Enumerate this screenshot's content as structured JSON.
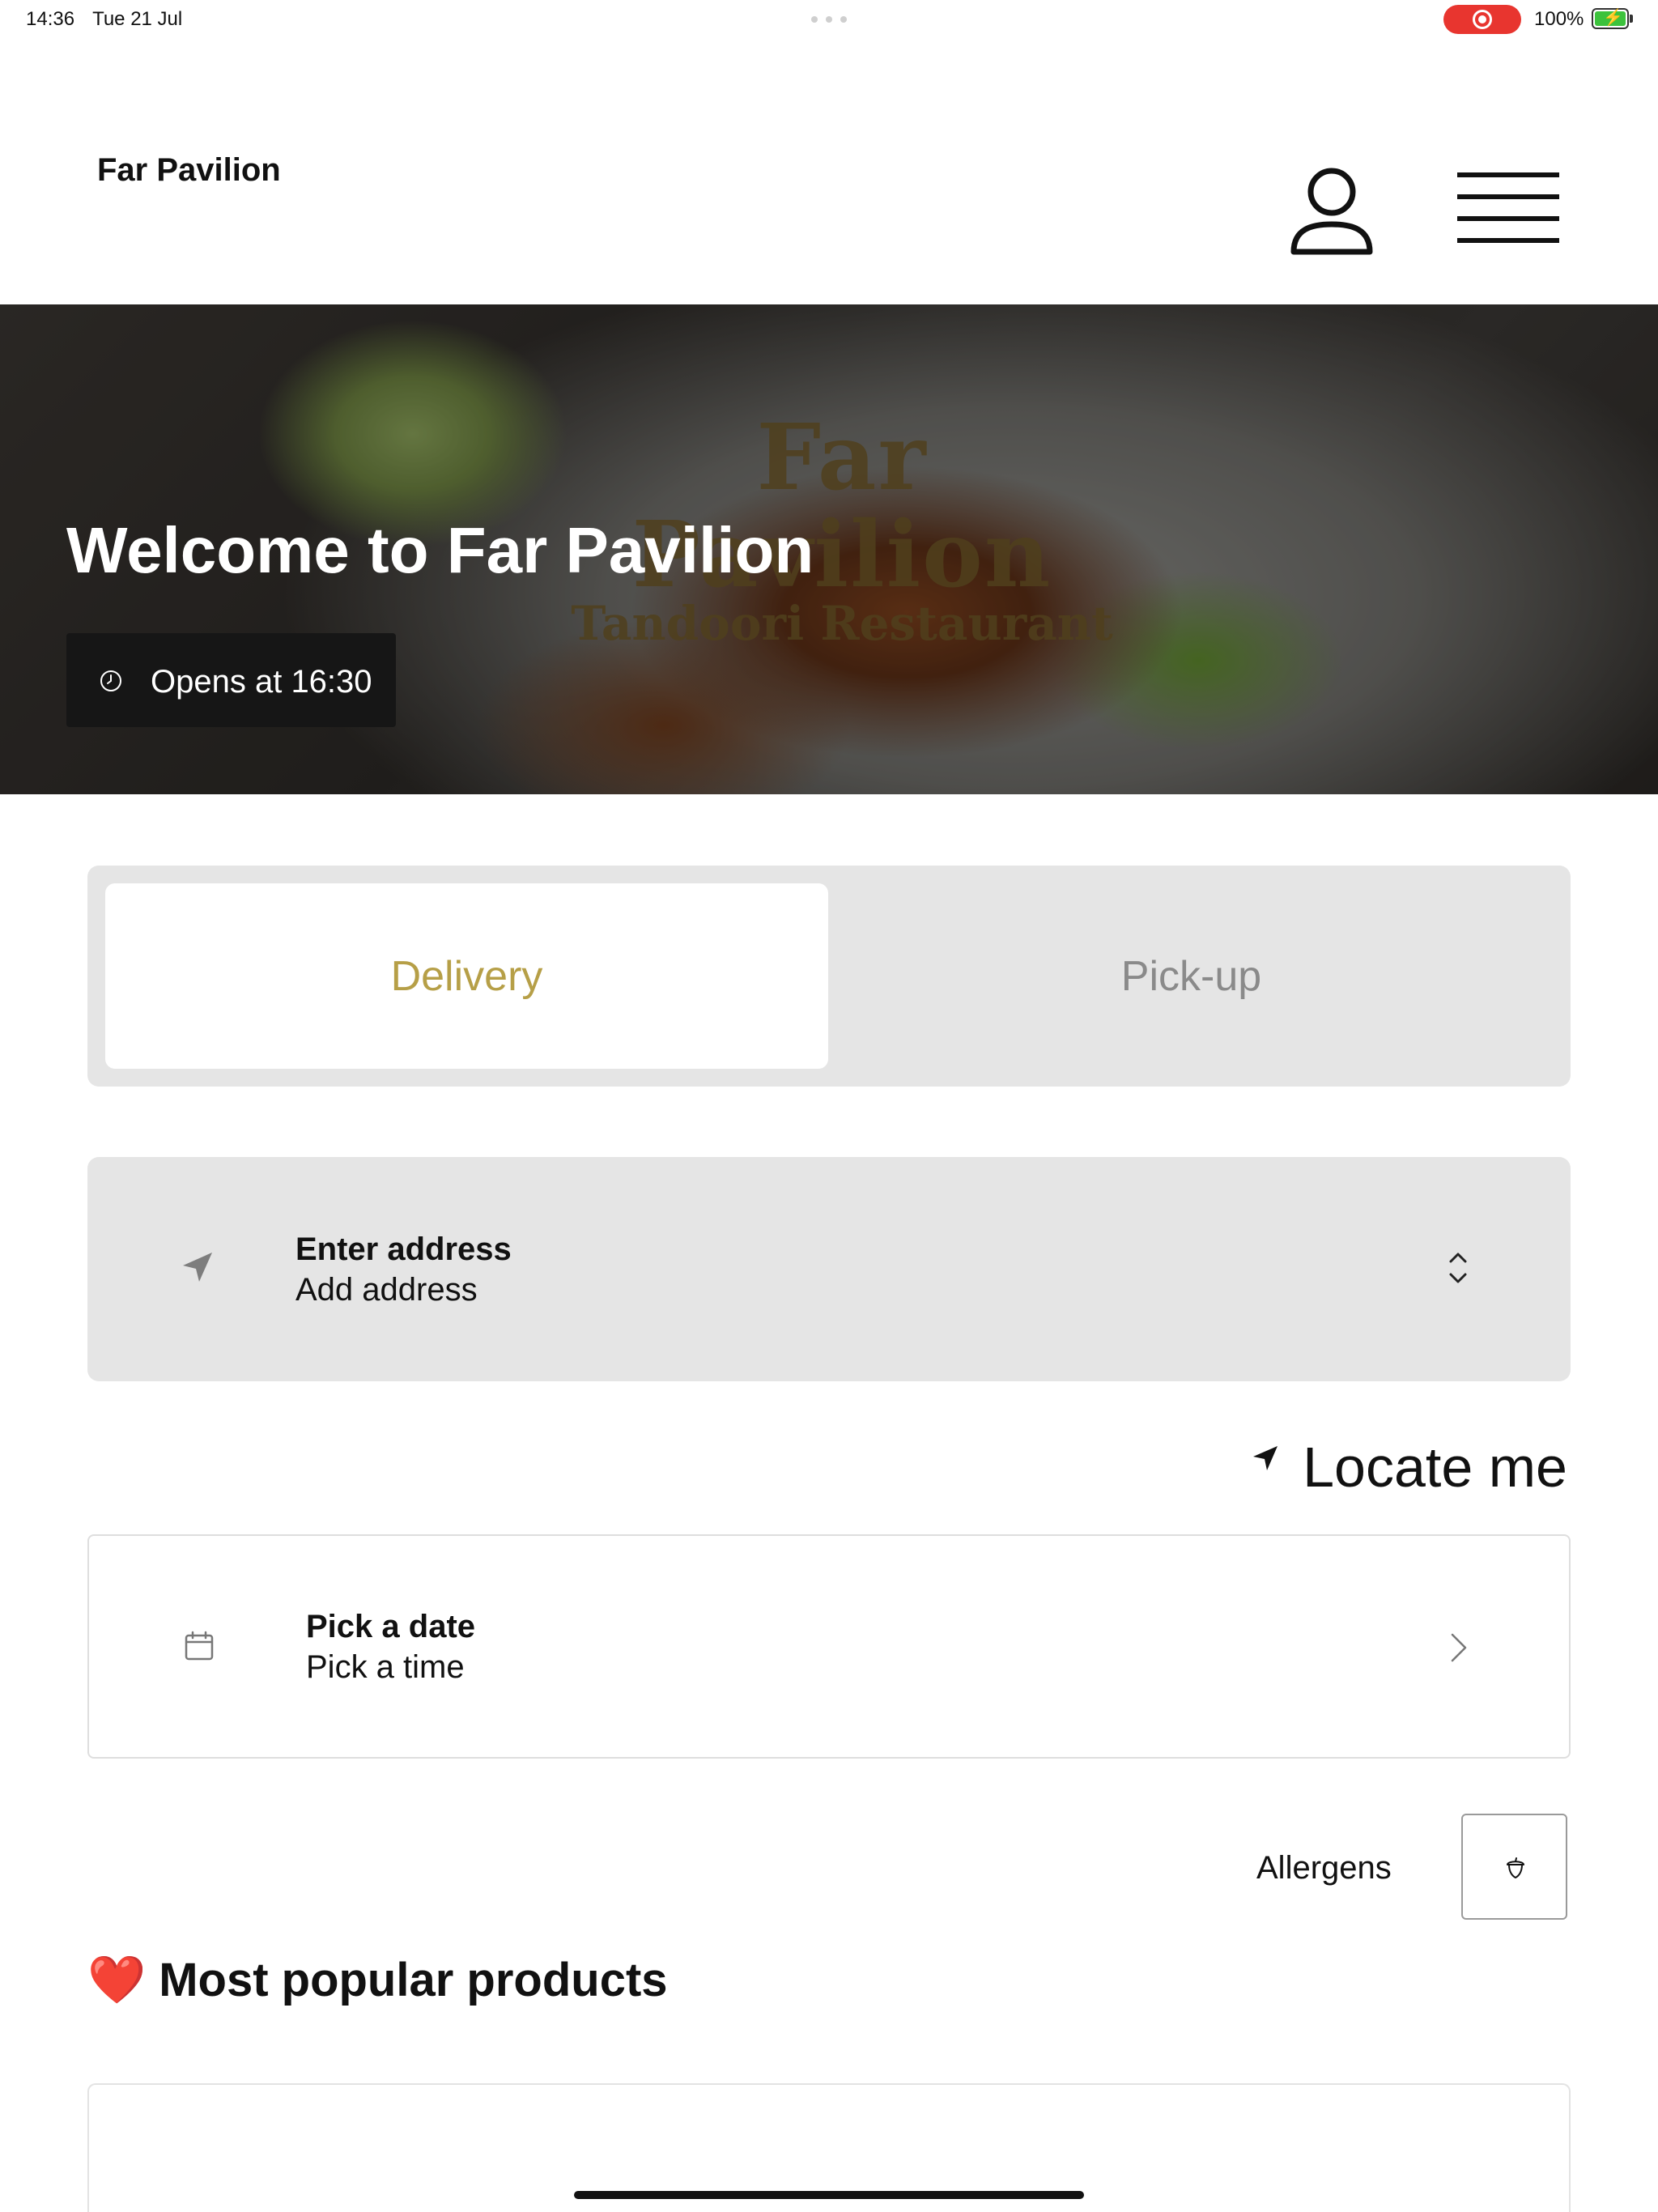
{
  "status_bar": {
    "time": "14:36",
    "date": "Tue 21 Jul",
    "battery": "100%",
    "record_color": "#e8352f"
  },
  "header": {
    "brand": "Far Pavilion",
    "account_icon": "person-icon",
    "menu_icon": "hamburger-menu-icon"
  },
  "hero": {
    "title": "Welcome to Far Pavilion",
    "watermark_line1": "Far Pavilion",
    "watermark_line2": "Tandoori Restaurant",
    "opening_text": "Opens at 16:30"
  },
  "mode_tabs": {
    "delivery": "Delivery",
    "pickup": "Pick-up",
    "selected": "Delivery",
    "accent_color": "#b69f47"
  },
  "address": {
    "title": "Enter address",
    "subtitle": "Add address"
  },
  "locate": {
    "label": "Locate me"
  },
  "schedule": {
    "title": "Pick a date",
    "subtitle": "Pick a time"
  },
  "allergens": {
    "label": "Allergens"
  },
  "popular": {
    "emoji": "❤️",
    "title": "Most popular products"
  }
}
